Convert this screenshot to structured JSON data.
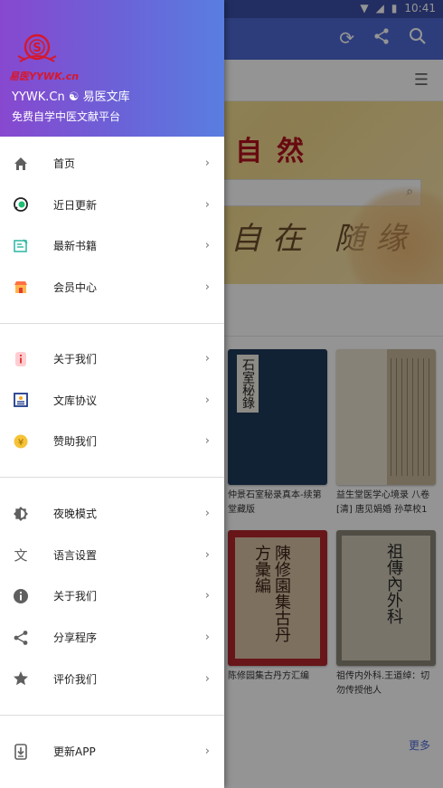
{
  "status_bar": {
    "time": "10:41"
  },
  "background": {
    "banner_title": "自然",
    "banner_calligraphy": "自在 随缘",
    "more_link": "更多",
    "books": [
      {
        "title": "仲景石室秘录真本-续第堂藏版",
        "cover_text": "石室秘錄",
        "cover_color": "#1f3c5c"
      },
      {
        "title": "益生堂医学心境录 八卷 [清] 唐见娟婚 孙草校1",
        "cover_text": "",
        "cover_color": "#c9b79a"
      },
      {
        "title": "陈修园集古丹方汇编",
        "cover_text": "陳修園集古丹方彙編",
        "cover_color": "#b3262c"
      },
      {
        "title": "祖传内外科.王道绰：切勿传授他人",
        "cover_text": "祖傳內外科",
        "cover_color": "#8a8578"
      }
    ]
  },
  "drawer": {
    "logo_text": "易医YYWK.cn",
    "header_title": "YYWK.Cn ☯ 易医文库",
    "header_subtitle": "免费自学中医文献平台",
    "accent_color": "#8748cf",
    "groups": [
      [
        {
          "label": "首页",
          "icon": "home-icon"
        },
        {
          "label": "近日更新",
          "icon": "chat-icon"
        },
        {
          "label": "最新书籍",
          "icon": "edit-book-icon"
        },
        {
          "label": "会员中心",
          "icon": "shop-icon"
        }
      ],
      [
        {
          "label": "关于我们",
          "icon": "info-icon"
        },
        {
          "label": "文库协议",
          "icon": "agreement-icon"
        },
        {
          "label": "赞助我们",
          "icon": "coin-icon"
        }
      ],
      [
        {
          "label": "夜晚模式",
          "icon": "night-mode-icon"
        },
        {
          "label": "语言设置",
          "icon": "translate-icon"
        },
        {
          "label": "关于我们",
          "icon": "info-circle-icon"
        },
        {
          "label": "分享程序",
          "icon": "share-icon"
        },
        {
          "label": "评价我们",
          "icon": "star-icon"
        }
      ],
      [
        {
          "label": "更新APP",
          "icon": "download-icon"
        }
      ]
    ],
    "chevron": "›"
  }
}
